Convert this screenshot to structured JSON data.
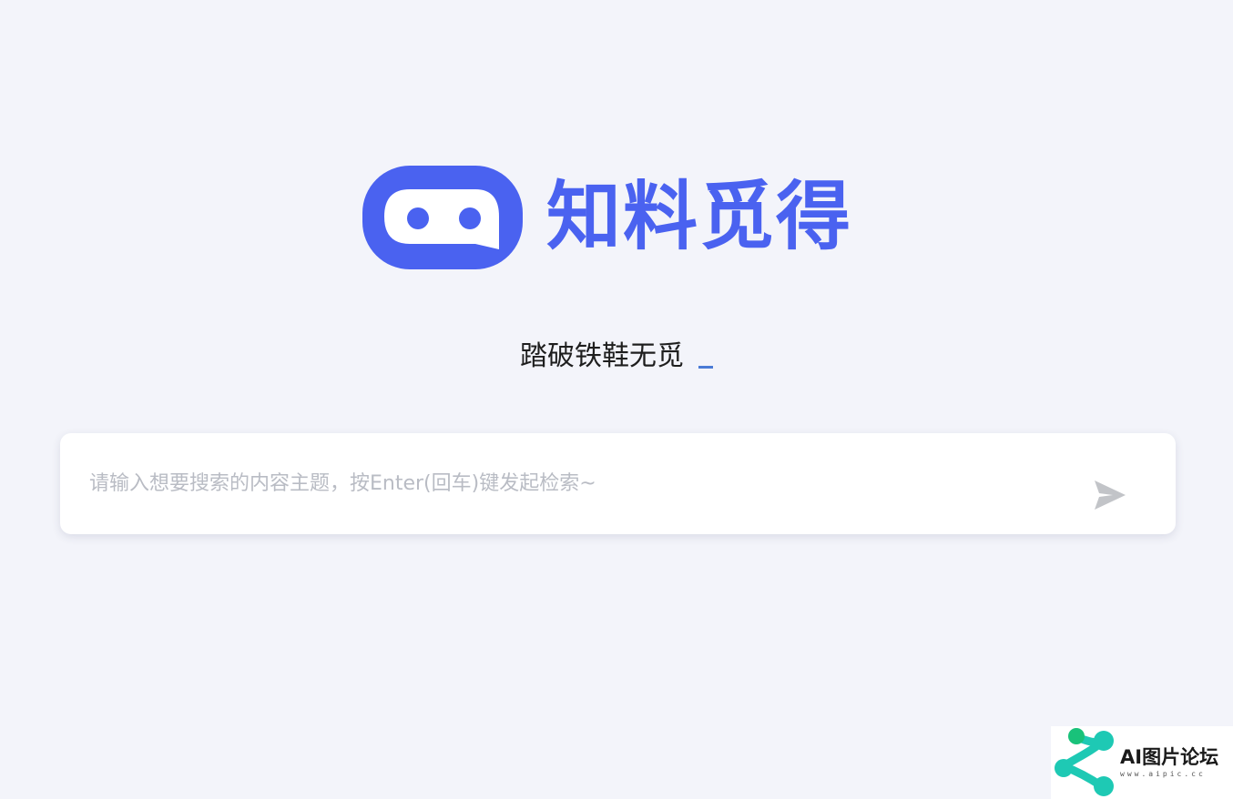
{
  "brand": {
    "name": "知料觅得",
    "color": "#4a62f0"
  },
  "tagline": {
    "text": "踏破铁鞋无觅"
  },
  "search": {
    "placeholder": "请输入想要搜索的内容主题，按Enter(回车)键发起检索~",
    "value": "",
    "submit_icon": "send-icon"
  },
  "watermark": {
    "title": "AI图片论坛",
    "url": "www.aipic.cc"
  },
  "colors": {
    "background": "#f3f4fa",
    "accent": "#4a62f0",
    "cursor": "#4a7bd6",
    "send_icon": "#c2c4c8",
    "watermark_teal": "#1ec9b4",
    "watermark_green": "#19c27a"
  }
}
